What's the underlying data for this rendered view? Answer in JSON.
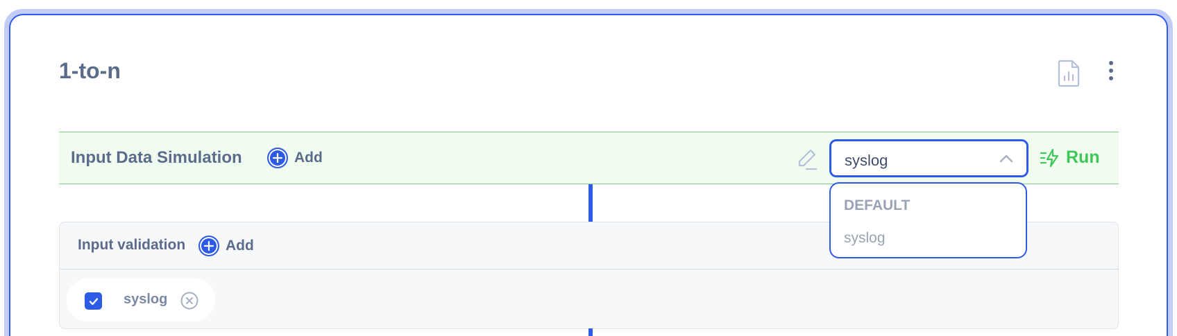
{
  "header": {
    "title": "1-to-n"
  },
  "icons": {
    "report": "report-file-icon",
    "more": "more-vertical-icon",
    "edit": "pencil-icon",
    "run": "lightning-run-icon",
    "add": "plus-circle-icon",
    "close": "close-circle-icon",
    "check": "checkmark-icon"
  },
  "simulation": {
    "title": "Input Data Simulation",
    "add_label": "Add",
    "select_value": "syslog",
    "run_label": "Run",
    "dropdown_options": [
      "DEFAULT",
      "syslog"
    ]
  },
  "validation": {
    "title": "Input validation",
    "add_label": "Add",
    "items": [
      {
        "label": "syslog",
        "checked": true
      }
    ]
  },
  "colors": {
    "accent": "#2e5be6",
    "run_green": "#3fc858",
    "sim_bg": "#f1fcf1",
    "text": "#5b6b8a"
  }
}
